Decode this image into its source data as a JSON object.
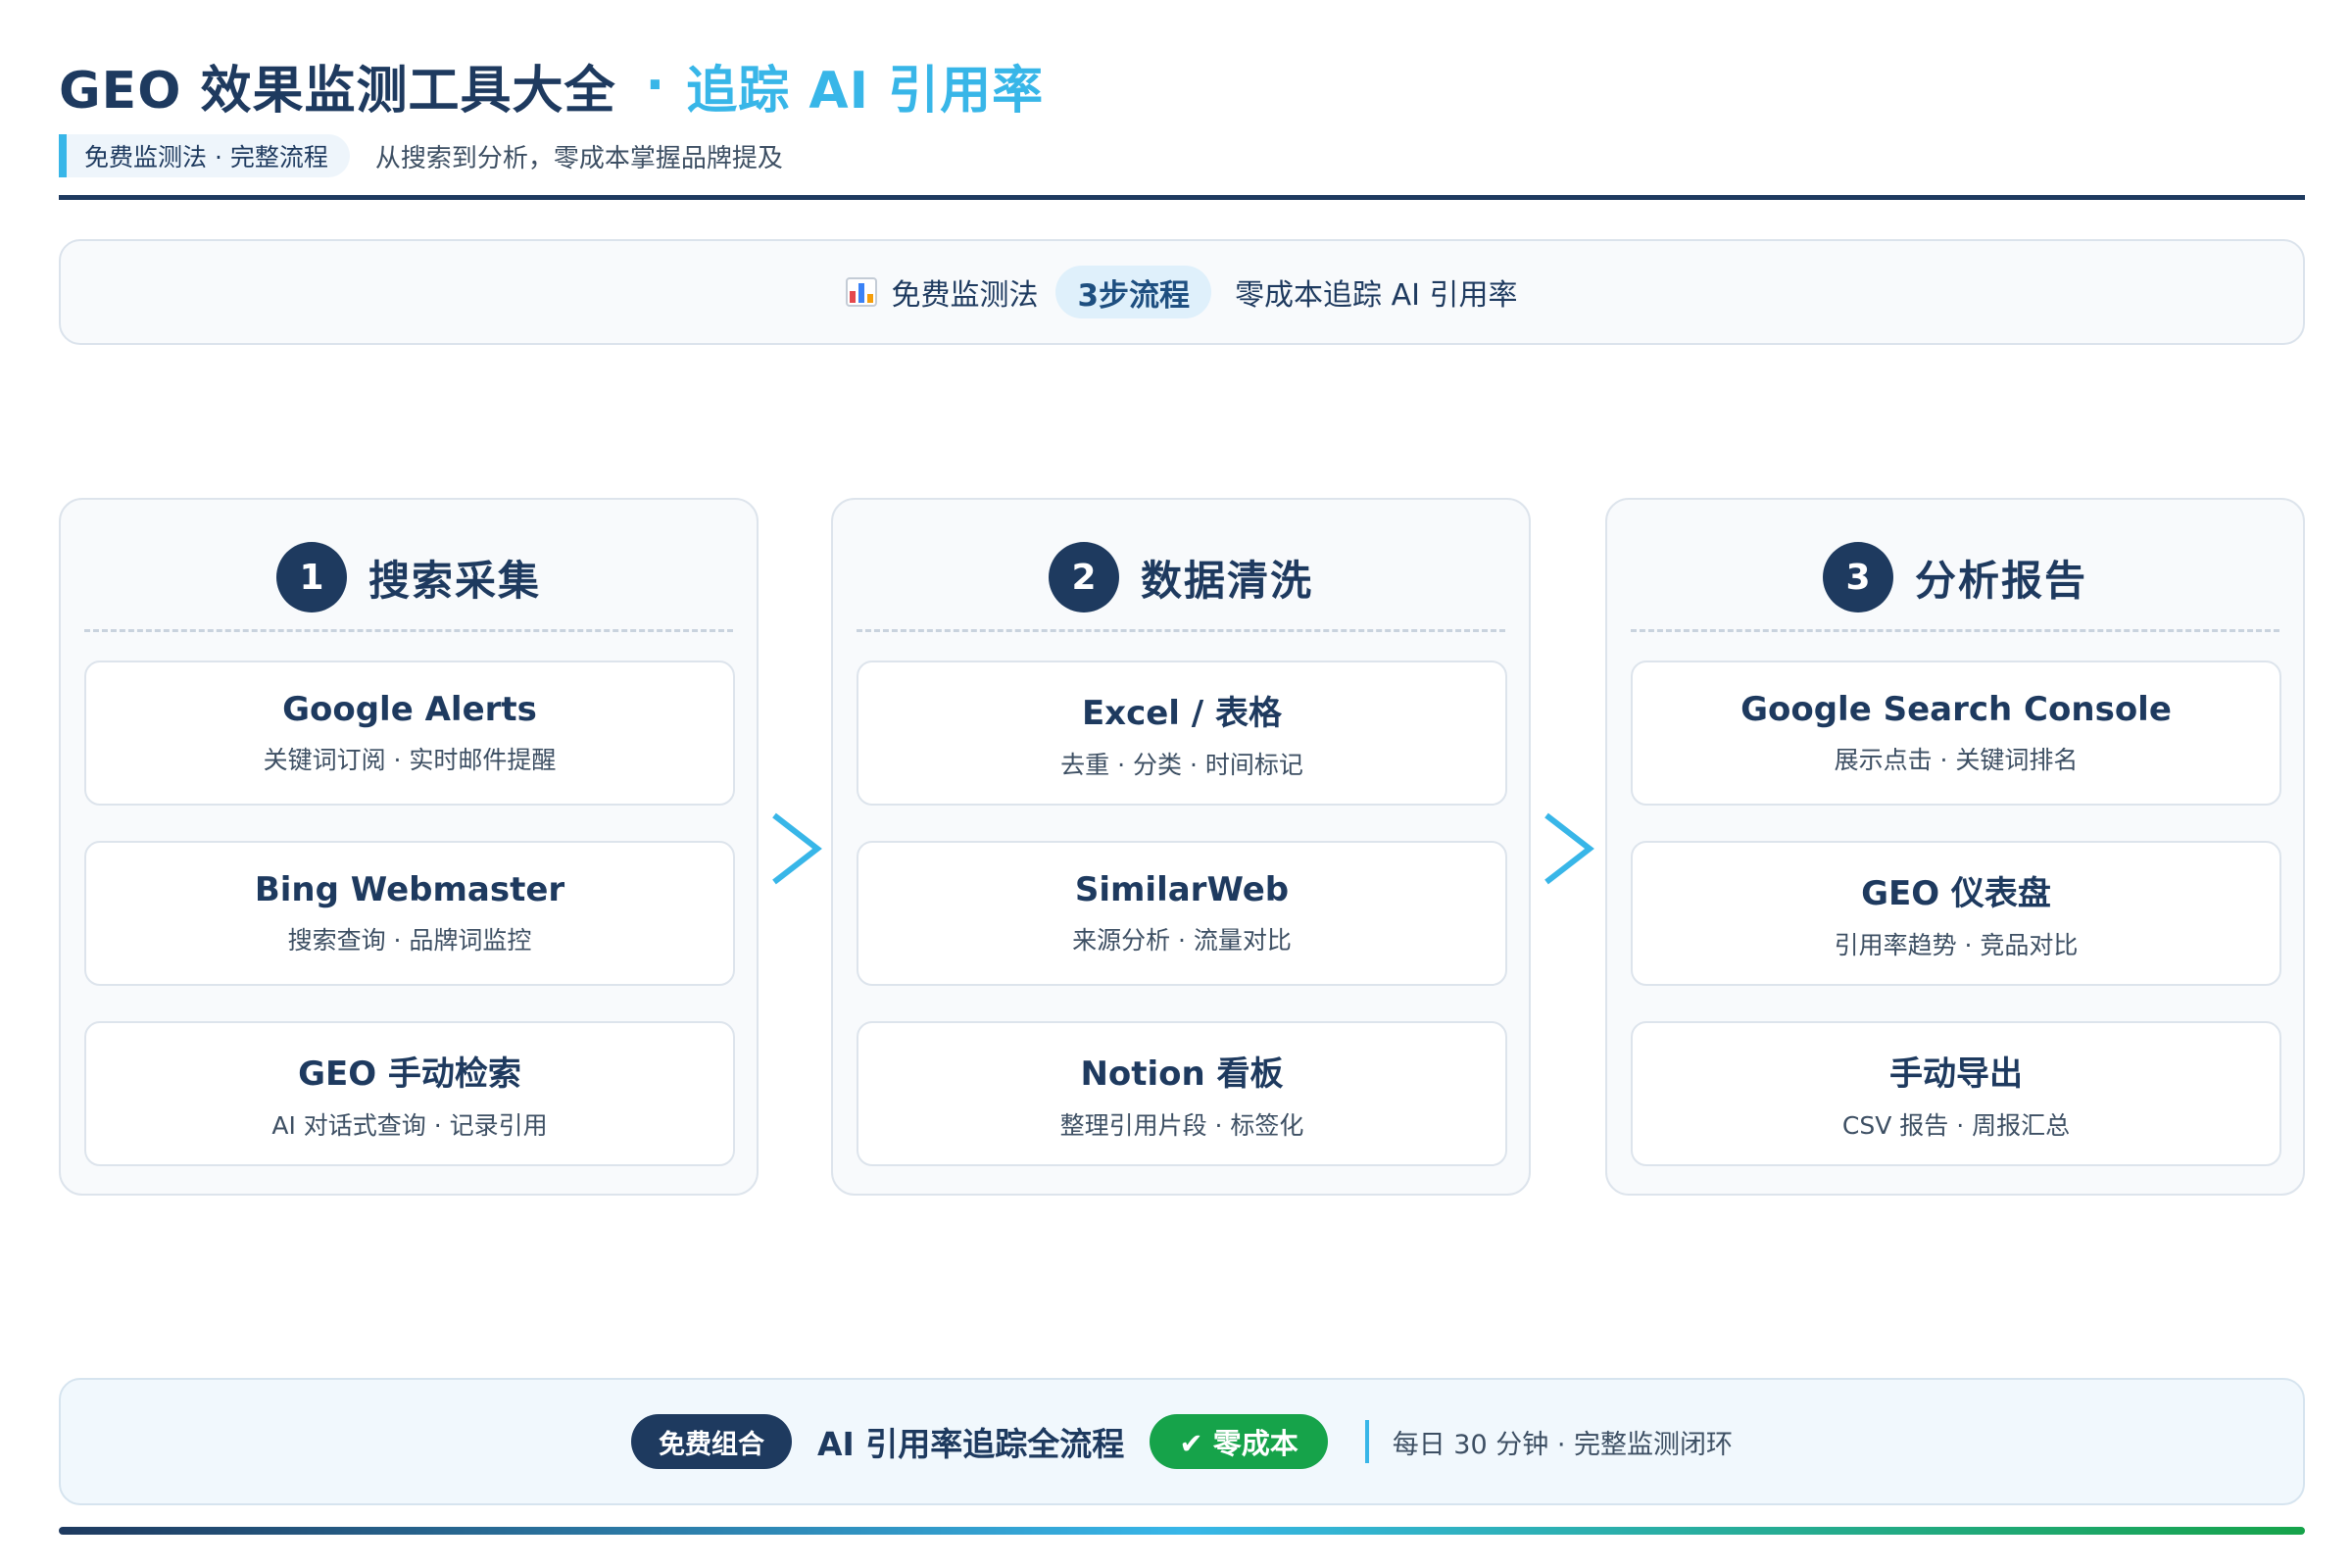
{
  "header": {
    "title_main": "GEO 效果监测工具大全",
    "title_sep": "·",
    "title_accent": "追踪 AI 引用率",
    "tag": "免费监测法 · 完整流程",
    "subtitle": "从搜索到分析，零成本掌握品牌提及"
  },
  "summary": {
    "icon": "bar-chart-icon",
    "label": "免费监测法",
    "pill": "3步流程",
    "after": "零成本追踪 AI 引用率"
  },
  "steps": [
    {
      "num": "1",
      "title": "搜索采集",
      "cards": [
        {
          "title": "Google Alerts",
          "desc": "关键词订阅 · 实时邮件提醒"
        },
        {
          "title": "Bing Webmaster",
          "desc": "搜索查询 · 品牌词监控"
        },
        {
          "title": "GEO 手动检索",
          "desc": "AI 对话式查询 · 记录引用"
        }
      ]
    },
    {
      "num": "2",
      "title": "数据清洗",
      "cards": [
        {
          "title": "Excel / 表格",
          "desc": "去重 · 分类 · 时间标记"
        },
        {
          "title": "SimilarWeb",
          "desc": "来源分析 · 流量对比"
        },
        {
          "title": "Notion 看板",
          "desc": "整理引用片段 · 标签化"
        }
      ]
    },
    {
      "num": "3",
      "title": "分析报告",
      "cards": [
        {
          "title": "Google Search Console",
          "desc": "展示点击 · 关键词排名"
        },
        {
          "title": "GEO 仪表盘",
          "desc": "引用率趋势 · 竞品对比"
        },
        {
          "title": "手动导出",
          "desc": "CSV 报告 · 周报汇总"
        }
      ]
    }
  ],
  "footer": {
    "badge": "免费组合",
    "title": "AI 引用率追踪全流程",
    "green_badge": "✔ 零成本",
    "note": "每日 30 分钟 · 完整监测闭环"
  },
  "colors": {
    "primary": "#1e3a5f",
    "accent": "#38b6e8",
    "success": "#16a34a"
  }
}
